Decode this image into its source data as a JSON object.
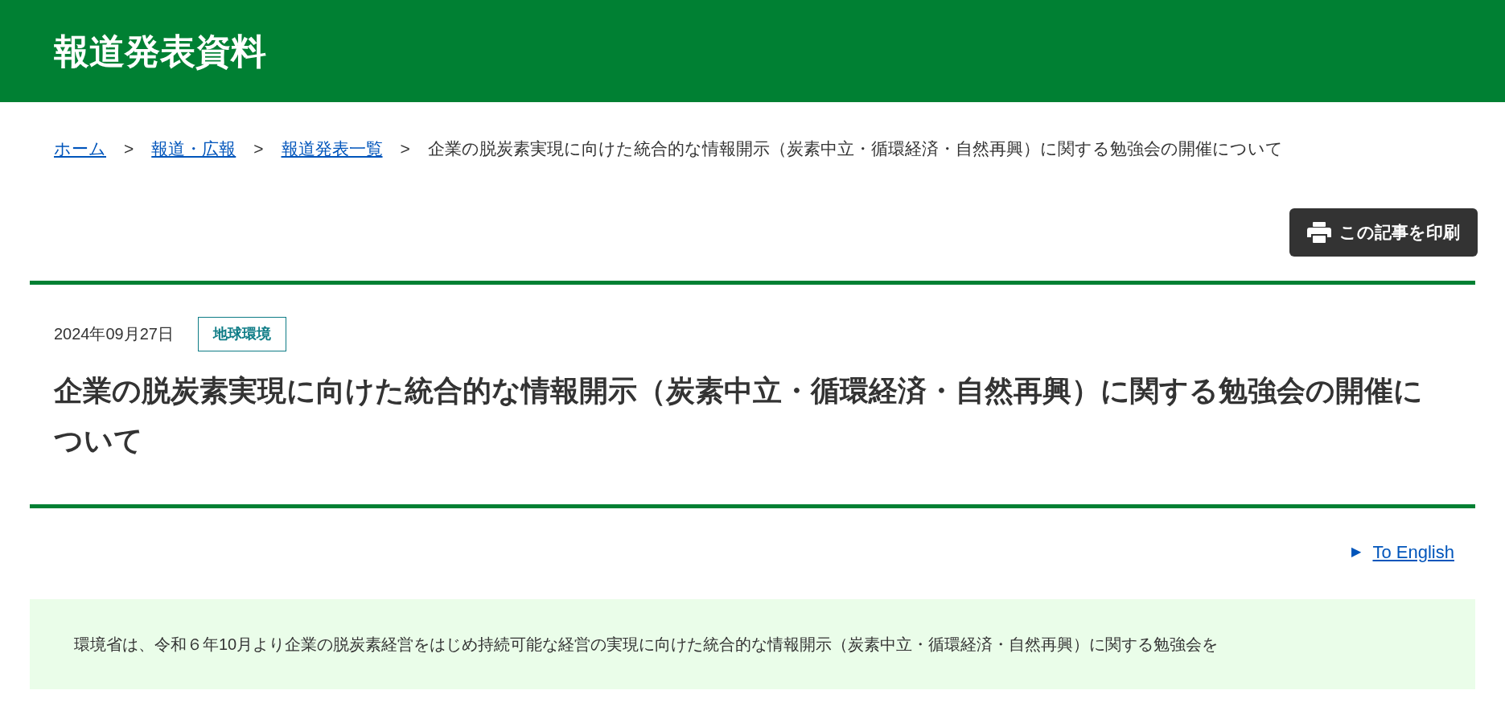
{
  "header": {
    "title": "報道発表資料"
  },
  "breadcrumb": {
    "links": [
      "ホーム",
      "報道・広報",
      "報道発表一覧"
    ],
    "separator": ">",
    "current": "企業の脱炭素実現に向けた統合的な情報開示（炭素中立・循環経済・自然再興）に関する勉強会の開催について"
  },
  "print_button": {
    "label": "この記事を印刷"
  },
  "article": {
    "date": "2024年09月27日",
    "tag": "地球環境",
    "title": "企業の脱炭素実現に向けた統合的な情報開示（炭素中立・循環経済・自然再興）に関する勉強会の開催について"
  },
  "language_link": {
    "marker": "▶",
    "label": "To English"
  },
  "summary": {
    "text": "環境省は、令和６年10月より企業の脱炭素経営をはじめ持続可能な経営の実現に向けた統合的な情報開示（炭素中立・循環経済・自然再興）に関する勉強会を"
  }
}
